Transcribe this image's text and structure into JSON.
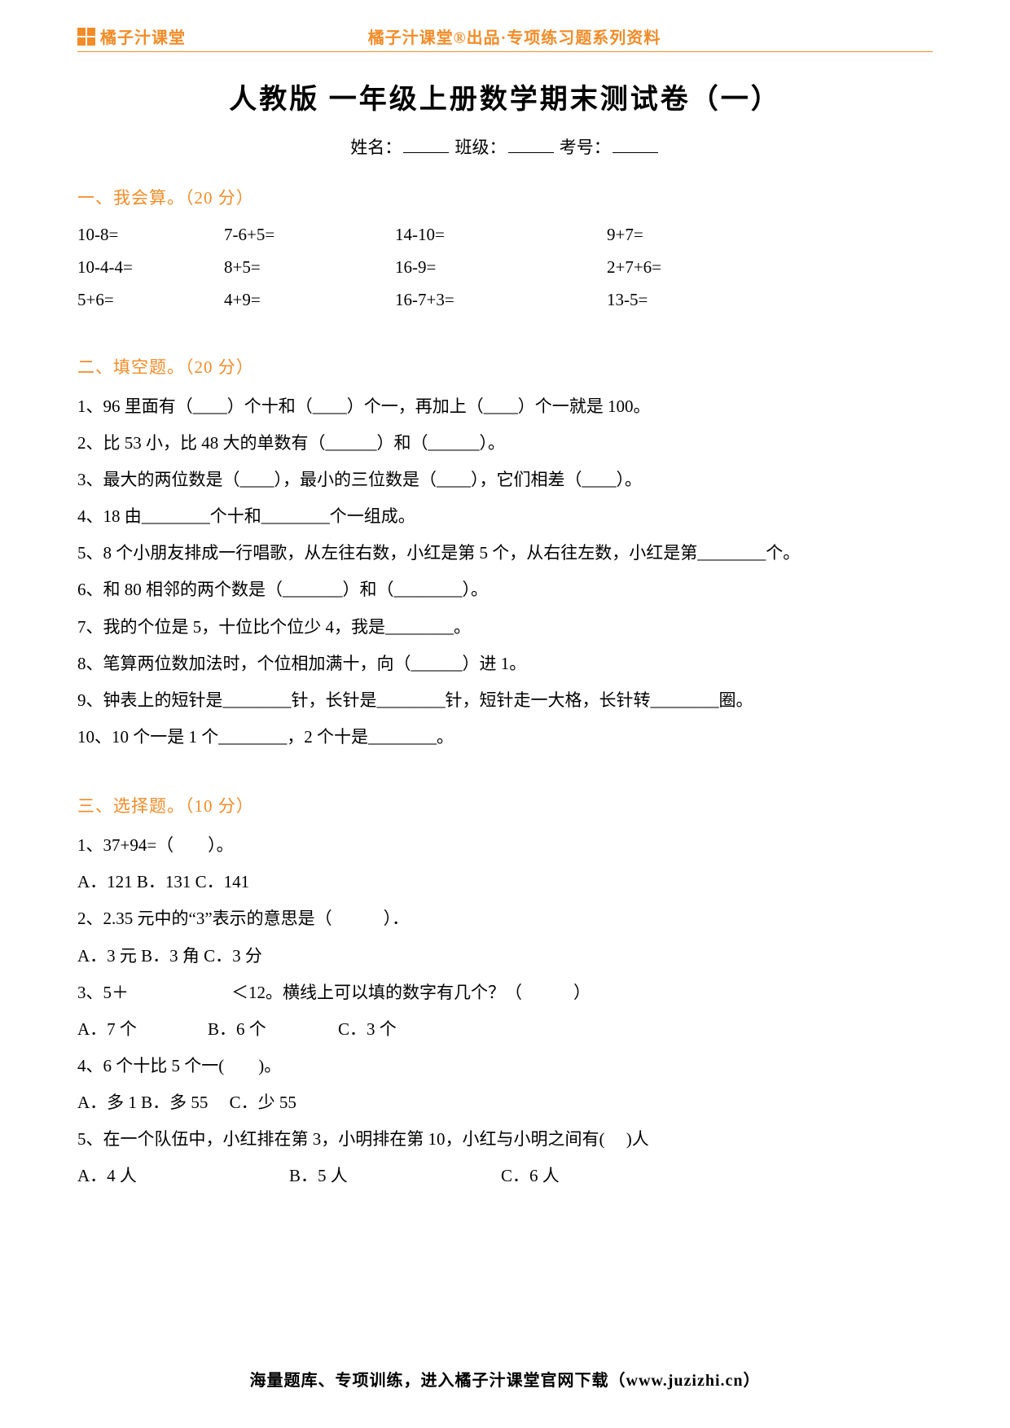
{
  "header": {
    "logo_text": "橘子汁课堂",
    "brand_line": "橘子汁课堂®出品·专项练习题系列资料"
  },
  "title": "人教版 一年级上册数学期末测试卷（一）",
  "info": {
    "name_label": "姓名：",
    "class_label": "班级：",
    "exam_label": "考号："
  },
  "section1": {
    "head": "一、我会算。（20 分）",
    "rows": [
      {
        "c1": "10-8=",
        "c2": "7-6+5=",
        "c3": "14-10=",
        "c4": "9+7="
      },
      {
        "c1": "10-4-4=",
        "c2": "8+5=",
        "c3": "16-9=",
        "c4": "2+7+6="
      },
      {
        "c1": "5+6=",
        "c2": "4+9=",
        "c3": "16-7+3=",
        "c4": "13-5="
      }
    ]
  },
  "section2": {
    "head": "二、填空题。（20 分）",
    "items": [
      "1、96 里面有（____）个十和（____）个一，再加上（____）个一就是 100。",
      "2、比 53 小，比 48 大的单数有（______）和（______）。",
      "3、最大的两位数是（____），最小的三位数是（____），它们相差（____）。",
      "4、18 由________个十和________个一组成。",
      "5、8 个小朋友排成一行唱歌，从左往右数，小红是第 5 个，从右往左数，小红是第________个。",
      "6、和 80 相邻的两个数是（_______）和（________）。",
      "7、我的个位是 5，十位比个位少 4，我是________。",
      "8、笔算两位数加法时，个位相加满十，向（______）进 1。",
      "9、钟表上的短针是________针，长针是________针，短针走一大格，长针转________圈。",
      "10、10 个一是 1 个________，2 个十是________。"
    ]
  },
  "section3": {
    "head": "三、选择题。（10 分）",
    "q1": {
      "stem": "1、37+94=（　　）。",
      "opts": "A．121 B．131 C．141"
    },
    "q2": {
      "stem": "2、2.35 元中的“3”表示的意思是（　　　）．",
      "opts": "A．3 元 B．3 角 C．3 分"
    },
    "q3": {
      "stem": "3、5＋　　　　　　＜12。横线上可以填的数字有几个？（　　　）",
      "a": "A．7 个",
      "b": "B．6 个",
      "c": "C．3 个"
    },
    "q4": {
      "stem": "4、6 个十比 5 个一(　　)。",
      "opts": "A．多 1 B．多 55　 C．少 55"
    },
    "q5": {
      "stem": "5、在一个队伍中，小红排在第 3，小明排在第 10，小红与小明之间有(　 )人",
      "a": "A．4 人",
      "b": "B．5 人",
      "c": "C．6 人"
    }
  },
  "footer": "海量题库、专项训练，进入橘子汁课堂官网下载（www.juzizhi.cn）"
}
